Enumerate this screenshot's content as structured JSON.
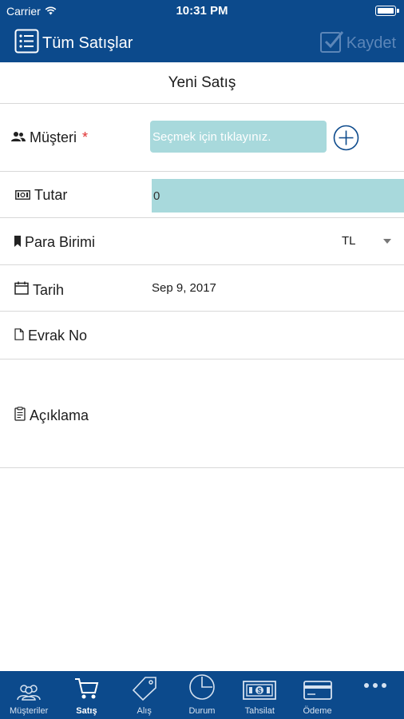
{
  "status": {
    "carrier": "Carrier",
    "time": "10:31 PM"
  },
  "nav": {
    "back_label": "Tüm Satışlar",
    "save_label": "Kaydet"
  },
  "page": {
    "title": "Yeni Satış"
  },
  "form": {
    "musteri": {
      "label": "Müşteri",
      "required_mark": "*",
      "placeholder": "Seçmek için tıklayınız."
    },
    "tutar": {
      "label": "Tutar",
      "value": "0"
    },
    "para_birimi": {
      "label": "Para Birimi",
      "value": "TL"
    },
    "tarih": {
      "label": "Tarih",
      "value": "Sep 9, 2017"
    },
    "evrak_no": {
      "label": "Evrak No"
    },
    "aciklama": {
      "label": "Açıklama"
    }
  },
  "tabs": [
    {
      "label": "Müşteriler",
      "icon": "users-icon"
    },
    {
      "label": "Satış",
      "icon": "cart-icon",
      "active": true
    },
    {
      "label": "Alış",
      "icon": "tag-icon"
    },
    {
      "label": "Durum",
      "icon": "pie-chart-icon"
    },
    {
      "label": "Tahsilat",
      "icon": "cash-icon"
    },
    {
      "label": "Ödeme",
      "icon": "credit-card-icon"
    },
    {
      "label": "",
      "icon": "more-icon"
    }
  ],
  "colors": {
    "primary": "#0c4a8c",
    "input_fill": "#a8d9dc",
    "required": "#e03030",
    "save_disabled": "#5c86b8"
  }
}
